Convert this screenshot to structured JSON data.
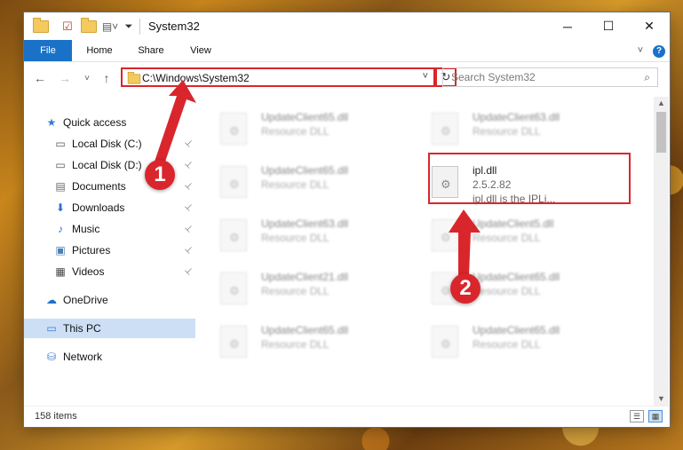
{
  "window": {
    "title": "System32",
    "controls": {
      "minimize": "─",
      "maximize": "☐",
      "close": "✕"
    }
  },
  "ribbon": {
    "tabs": [
      "File",
      "Home",
      "Share",
      "View"
    ],
    "expand": "˅",
    "help": "?"
  },
  "navigation": {
    "back": "←",
    "forward": "→",
    "recent": "˅",
    "up": "↑",
    "address": "C:\\Windows\\System32",
    "address_dropdown": "˅",
    "refresh": "↻",
    "search_placeholder": "Search System32",
    "search_icon": "🔍"
  },
  "sidebar": {
    "items": [
      {
        "label": "Quick access",
        "icon": "star-icon",
        "glyph": "★",
        "color": "#3a7bd5",
        "pinned": false
      },
      {
        "label": "Local Disk (C:)",
        "icon": "drive-icon",
        "glyph": "▭",
        "color": "#555555",
        "pinned": true
      },
      {
        "label": "Local Disk (D:)",
        "icon": "drive-icon",
        "glyph": "▭",
        "color": "#555555",
        "pinned": true
      },
      {
        "label": "Documents",
        "icon": "documents-icon",
        "glyph": "▤",
        "color": "#6a6a6a",
        "pinned": true
      },
      {
        "label": "Downloads",
        "icon": "downloads-icon",
        "glyph": "⬇",
        "color": "#2d6fd2",
        "pinned": true
      },
      {
        "label": "Music",
        "icon": "music-icon",
        "glyph": "♪",
        "color": "#2d6fd2",
        "pinned": true
      },
      {
        "label": "Pictures",
        "icon": "pictures-icon",
        "glyph": "▣",
        "color": "#4a7fb5",
        "pinned": true
      },
      {
        "label": "Videos",
        "icon": "videos-icon",
        "glyph": "▦",
        "color": "#444444",
        "pinned": true
      },
      {
        "label": "OneDrive",
        "icon": "cloud-icon",
        "glyph": "☁",
        "color": "#1a72c8",
        "pinned": false
      },
      {
        "label": "This PC",
        "icon": "computer-icon",
        "glyph": "▭",
        "color": "#3a7bd5",
        "pinned": false,
        "selected": true
      },
      {
        "label": "Network",
        "icon": "network-icon",
        "glyph": "⛁",
        "color": "#3a7bd5",
        "pinned": false
      }
    ],
    "pin_glyph": "📌"
  },
  "files": [
    {
      "name": "UpdateClient65.dll",
      "desc": "Resource DLL",
      "blurred": true
    },
    {
      "name": "UpdateClient63.dll",
      "desc": "Resource DLL",
      "blurred": true
    },
    {
      "name": "UpdateClient65.dll",
      "desc": "Resource DLL",
      "blurred": true
    },
    {
      "name": "ipl.dll",
      "desc": "2.5.2.82",
      "desc2": "ipl.dll is the IPLi...",
      "blurred": false,
      "highlighted": true
    },
    {
      "name": "UpdateClient63.dll",
      "desc": "Resource DLL",
      "blurred": true
    },
    {
      "name": "UpdateClient5.dll",
      "desc": "Resource DLL",
      "blurred": true
    },
    {
      "name": "UpdateClient21.dll",
      "desc": "Resource DLL",
      "blurred": true
    },
    {
      "name": "UpdateClient65.dll",
      "desc": "Resource DLL",
      "blurred": true
    },
    {
      "name": "UpdateClient65.dll",
      "desc": "Resource DLL",
      "blurred": true
    },
    {
      "name": "UpdateClient65.dll",
      "desc": "Resource DLL",
      "blurred": true
    }
  ],
  "status": {
    "items": "158 items"
  },
  "annotations": {
    "step1": "1",
    "step2": "2",
    "color": "#d9262c"
  }
}
